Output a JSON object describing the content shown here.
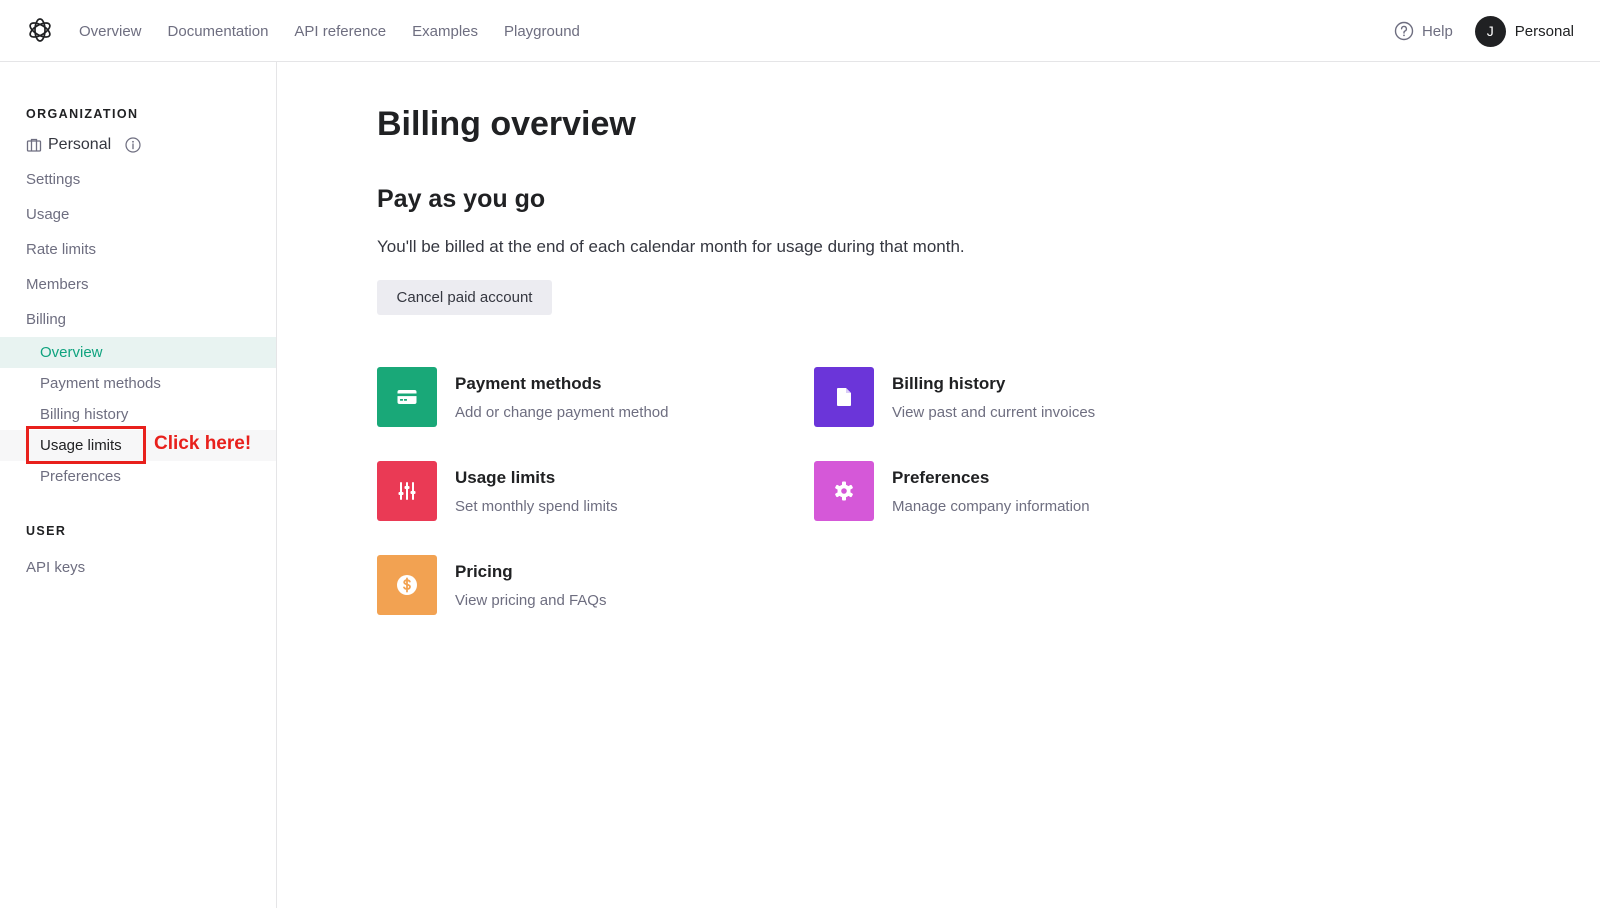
{
  "topnav": {
    "items": [
      "Overview",
      "Documentation",
      "API reference",
      "Examples",
      "Playground"
    ],
    "help_label": "Help",
    "avatar_initial": "J",
    "account_label": "Personal"
  },
  "sidebar": {
    "org_heading": "ORGANIZATION",
    "org_name": "Personal",
    "items": [
      "Settings",
      "Usage",
      "Rate limits",
      "Members",
      "Billing"
    ],
    "billing_sub": [
      "Overview",
      "Payment methods",
      "Billing history",
      "Usage limits",
      "Preferences"
    ],
    "user_heading": "USER",
    "user_items": [
      "API keys"
    ],
    "annotation": "Click here!"
  },
  "main": {
    "title": "Billing overview",
    "plan_title": "Pay as you go",
    "plan_desc": "You'll be billed at the end of each calendar month for usage during that month.",
    "cancel_label": "Cancel paid account",
    "cards": [
      {
        "title": "Payment methods",
        "subtitle": "Add or change payment method",
        "color": "#19a878",
        "icon": "credit-card-icon"
      },
      {
        "title": "Billing history",
        "subtitle": "View past and current invoices",
        "color": "#6b35d9",
        "icon": "document-icon"
      },
      {
        "title": "Usage limits",
        "subtitle": "Set monthly spend limits",
        "color": "#ea3a55",
        "icon": "sliders-icon"
      },
      {
        "title": "Preferences",
        "subtitle": "Manage company information",
        "color": "#d558d8",
        "icon": "gear-icon"
      },
      {
        "title": "Pricing",
        "subtitle": "View pricing and FAQs",
        "color": "#f2a252",
        "icon": "dollar-icon"
      }
    ]
  },
  "colors": {
    "accent": "#10a37f",
    "annotation": "#e8201c"
  }
}
